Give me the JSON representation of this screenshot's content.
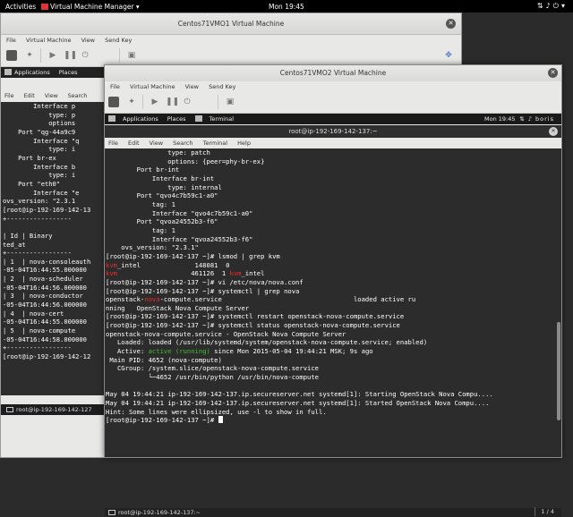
{
  "topbar": {
    "activities": "Activities",
    "app_name": "Virtual Machine Manager",
    "clock": "Mon 19:45"
  },
  "vm1": {
    "title": "Centos71VMO1 Virtual Machine",
    "menu": [
      "File",
      "Virtual Machine",
      "View",
      "Send Key"
    ],
    "guest_applications": "Applications",
    "guest_places": "Places",
    "term_menu": [
      "File",
      "Edit",
      "View",
      "Search"
    ],
    "terminal_lines": [
      "        Interface p",
      "            type: p",
      "            options",
      "    Port \"qg-44a9c9",
      "        Interface \"q",
      "            type: i",
      "    Port br-ex",
      "        Interface b",
      "            type: i",
      "    Port \"eth0\"",
      "        Interface \"e",
      "ovs_version: \"2.3.1",
      "[root@ip-192-169-142-13",
      "+-----------------",
      "",
      "| Id | Binary",
      "ted_at",
      "+-----------------",
      "| 1  | nova-consoleauth",
      "-05-04T16:44:55.000000",
      "| 2  | nova-scheduler",
      "-05-04T16:44:56.000000",
      "| 3  | nova-conductor",
      "-05-04T16:44:56.000000",
      "| 4  | nova-cert",
      "-05-04T16:44:55.000000",
      "| 5  | nova-compute",
      "-05-04T16:44:58.000000",
      "+-----------------",
      "[root@ip-192-169-142-12",
      "",
      "",
      "",
      ""
    ],
    "taskbar_label": "root@ip-192-169-142-127"
  },
  "vm2": {
    "title": "Centos71VMO2 Virtual Machine",
    "menu": [
      "File",
      "Virtual Machine",
      "View",
      "Send Key"
    ],
    "guest_applications": "Applications",
    "guest_places": "Places",
    "guest_terminal": "Terminal",
    "guest_clock": "Mon 19:45",
    "guest_user": "boris",
    "terminal": {
      "title": "root@ip-192-169-142-137:~",
      "menu": [
        "File",
        "Edit",
        "View",
        "Search",
        "Terminal",
        "Help"
      ],
      "prompt": "[root@ip-192-169-142-137 ~]# "
    },
    "taskbar_label": "root@ip-192-169-142-137:~",
    "pager": "1 / 4"
  },
  "colors": {
    "error_red": "#ef2929",
    "active_green": "#3fbf2f",
    "terminal_bg": "#2c2c2c"
  }
}
